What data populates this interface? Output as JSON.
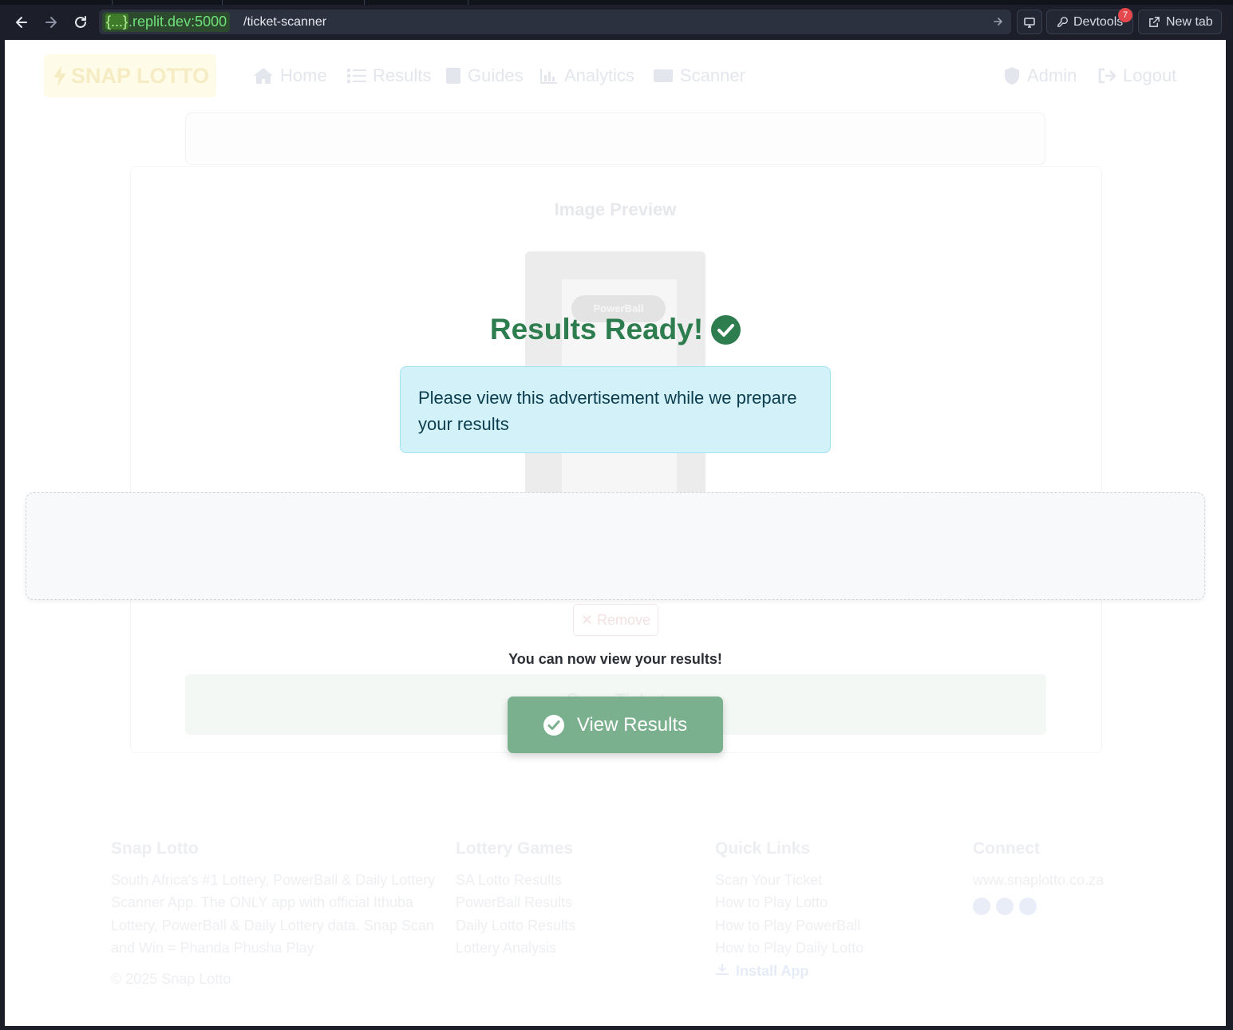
{
  "browser": {
    "url_host": {
      "brace": "{...}",
      "rest": ".replit.dev:5000"
    },
    "url_path": "/ticket-scanner",
    "devtools_label": "Devtools",
    "devtools_badge": "7",
    "new_tab_label": "New tab"
  },
  "site": {
    "logo_text": "SNAP LOTTO",
    "nav": {
      "home": "Home",
      "results": "Results",
      "guides": "Guides",
      "analytics": "Analytics",
      "scanner": "Scanner",
      "admin": "Admin",
      "logout": "Logout"
    },
    "image_preview_title": "Image Preview",
    "ticket_brand": "PowerBall",
    "remove_label": "✕ Remove",
    "scan_label": "Scan Ticket"
  },
  "modal": {
    "title": "Results Ready!",
    "ad_message": "Please view this advertisement while we prepare your results",
    "ready_label": "You can now view your results!",
    "view_results_label": "View Results"
  },
  "footer": {
    "col1": {
      "title": "Snap Lotto",
      "text": "South Africa's #1 Lottery, PowerBall & Daily Lottery Scanner App. The ONLY app with official Ithuba Lottery, PowerBall & Daily Lottery data. Snap Scan and Win = Phanda Phusha Play",
      "copyright": "© 2025 Snap Lotto"
    },
    "col2": {
      "title": "Lottery Games",
      "links": [
        "SA Lotto Results",
        "PowerBall Results",
        "Daily Lotto Results",
        "Lottery Analysis"
      ]
    },
    "col3": {
      "title": "Quick Links",
      "links": [
        "Scan Your Ticket",
        "How to Play Lotto",
        "How to Play PowerBall",
        "How to Play Daily Lotto"
      ],
      "install": "Install App"
    },
    "col4": {
      "title": "Connect",
      "website": "www.snaplotto.co.za"
    }
  },
  "colors": {
    "success": "#2e7d4f",
    "button_faded": "#7bb08f",
    "info_bg": "#d2f1f9"
  }
}
